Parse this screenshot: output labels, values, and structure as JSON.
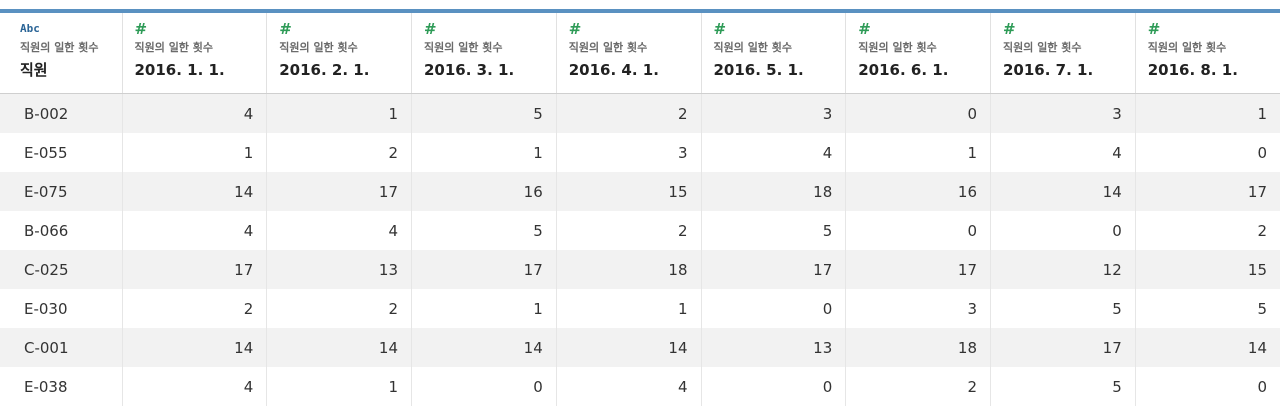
{
  "header": {
    "first_column": {
      "type_label": "Abc",
      "source": "직원의 일한 횟수",
      "field": "직원"
    },
    "date_columns": [
      {
        "type_label": "#",
        "source": "직원의 일한 횟수",
        "field": "2016. 1. 1."
      },
      {
        "type_label": "#",
        "source": "직원의 일한 횟수",
        "field": "2016. 2. 1."
      },
      {
        "type_label": "#",
        "source": "직원의 일한 횟수",
        "field": "2016. 3. 1."
      },
      {
        "type_label": "#",
        "source": "직원의 일한 횟수",
        "field": "2016. 4. 1."
      },
      {
        "type_label": "#",
        "source": "직원의 일한 횟수",
        "field": "2016. 5. 1."
      },
      {
        "type_label": "#",
        "source": "직원의 일한 횟수",
        "field": "2016. 6. 1."
      },
      {
        "type_label": "#",
        "source": "직원의 일한 횟수",
        "field": "2016. 7. 1."
      },
      {
        "type_label": "#",
        "source": "직원의 일한 횟수",
        "field": "2016. 8. 1."
      }
    ]
  },
  "rows": [
    {
      "employee": "B-002",
      "values": [
        "4",
        "1",
        "5",
        "2",
        "3",
        "0",
        "3",
        "1"
      ]
    },
    {
      "employee": "E-055",
      "values": [
        "1",
        "2",
        "1",
        "3",
        "4",
        "1",
        "4",
        "0"
      ]
    },
    {
      "employee": "E-075",
      "values": [
        "14",
        "17",
        "16",
        "15",
        "18",
        "16",
        "14",
        "17"
      ]
    },
    {
      "employee": "B-066",
      "values": [
        "4",
        "4",
        "5",
        "2",
        "5",
        "0",
        "0",
        "2"
      ]
    },
    {
      "employee": "C-025",
      "values": [
        "17",
        "13",
        "17",
        "18",
        "17",
        "17",
        "12",
        "15"
      ]
    },
    {
      "employee": "E-030",
      "values": [
        "2",
        "2",
        "1",
        "1",
        "0",
        "3",
        "5",
        "5"
      ]
    },
    {
      "employee": "C-001",
      "values": [
        "14",
        "14",
        "14",
        "14",
        "13",
        "18",
        "17",
        "14"
      ]
    },
    {
      "employee": "E-038",
      "values": [
        "4",
        "1",
        "0",
        "4",
        "0",
        "2",
        "5",
        "0"
      ]
    }
  ],
  "colors": {
    "accent_bar": "#5a91c1",
    "string_type": "#2a6496",
    "number_type": "#2e9b57"
  }
}
